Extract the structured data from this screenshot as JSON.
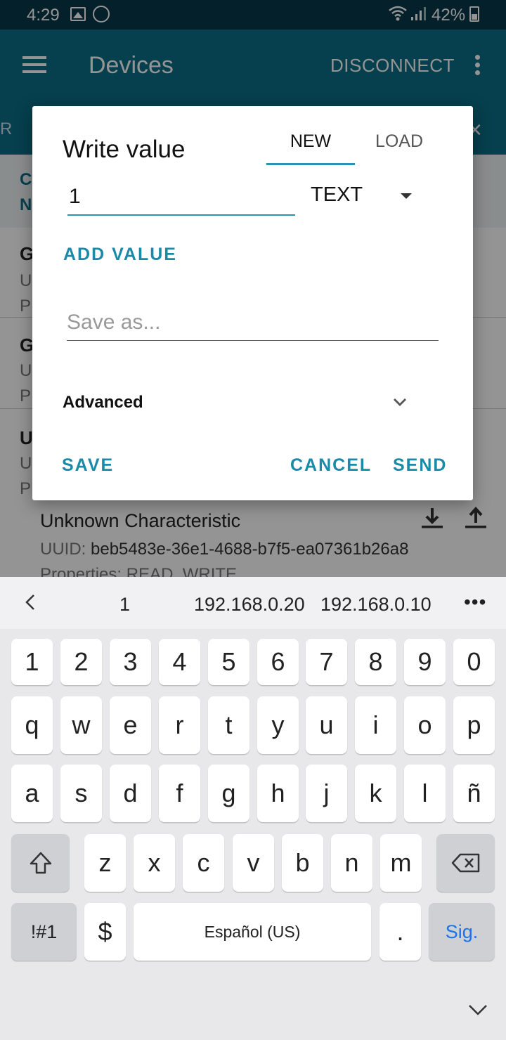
{
  "status_bar": {
    "time": "4:29",
    "battery": "42%",
    "icons": [
      "gallery-icon",
      "whatsapp-icon",
      "wifi-icon",
      "signal-icon",
      "battery-icon"
    ]
  },
  "app_bar": {
    "title": "Devices",
    "disconnect_label": "DISCONNECT",
    "tab_edge": "R",
    "close": "×"
  },
  "background": {
    "header_line1": "C",
    "header_line2": "N",
    "rows": [
      {
        "title": "G",
        "l1": "U",
        "l2": "P"
      },
      {
        "title": "G",
        "l1": "U",
        "l2": "P"
      },
      {
        "title": "U",
        "l1": "U",
        "l2": "P"
      }
    ],
    "characteristic": {
      "title": "Unknown Characteristic",
      "uuid_label": "UUID:",
      "uuid": "beb5483e-36e1-4688-b7f5-ea07361b26a8",
      "properties": "Properties: READ, WRITE"
    }
  },
  "dialog": {
    "title": "Write value",
    "tabs": {
      "new": "NEW",
      "load": "LOAD"
    },
    "value": "1",
    "type": "TEXT",
    "add_value": "ADD VALUE",
    "save_as_placeholder": "Save as...",
    "advanced": "Advanced",
    "buttons": {
      "save": "SAVE",
      "cancel": "CANCEL",
      "send": "SEND"
    }
  },
  "keyboard": {
    "suggestions": [
      "1",
      "192.168.0.20",
      "192.168.0.10"
    ],
    "more": "•••",
    "numbers": [
      "1",
      "2",
      "3",
      "4",
      "5",
      "6",
      "7",
      "8",
      "9",
      "0"
    ],
    "row1": [
      "q",
      "w",
      "e",
      "r",
      "t",
      "y",
      "u",
      "i",
      "o",
      "p"
    ],
    "row2": [
      "a",
      "s",
      "d",
      "f",
      "g",
      "h",
      "j",
      "k",
      "l",
      "ñ"
    ],
    "row3": [
      "z",
      "x",
      "c",
      "v",
      "b",
      "n",
      "m"
    ],
    "symbols": "!#1",
    "dollar": "$",
    "space": "Español (US)",
    "period": ".",
    "action": "Sig."
  },
  "colors": {
    "accent": "#1a8aa8",
    "app_bar": "#0b6d85",
    "status_bar": "#07394a"
  }
}
